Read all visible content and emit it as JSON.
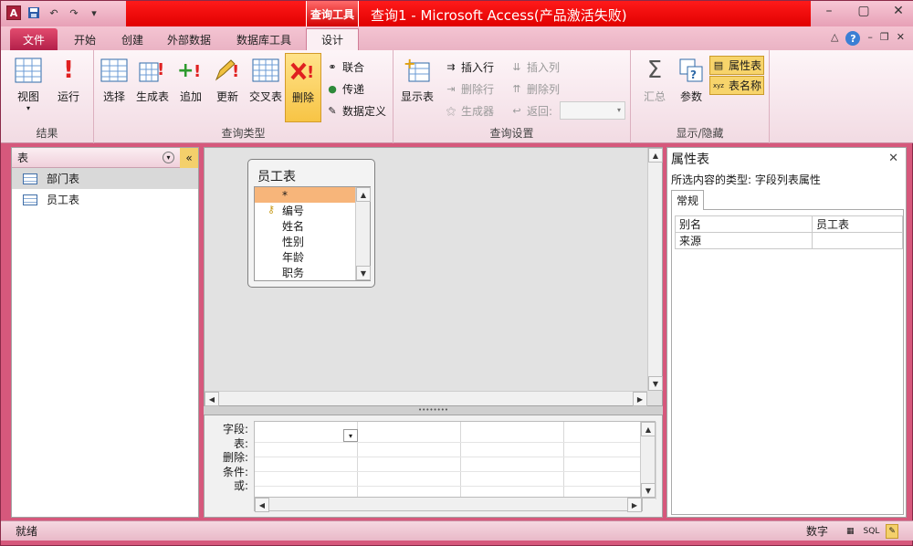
{
  "window": {
    "title": "查询1 - Microsoft Access(产品激活失败)",
    "context_tab": "查询工具"
  },
  "tabs": [
    {
      "label": "文件"
    },
    {
      "label": "开始"
    },
    {
      "label": "创建"
    },
    {
      "label": "外部数据"
    },
    {
      "label": "数据库工具"
    },
    {
      "label": "设计"
    }
  ],
  "ribbon": {
    "results": {
      "label": "结果",
      "view": "视图",
      "run": "运行"
    },
    "query_type": {
      "label": "查询类型",
      "select": "选择",
      "make_table": "生成表",
      "append": "追加",
      "update": "更新",
      "crosstab": "交叉表",
      "delete": "删除",
      "union": "联合",
      "pass_through": "传递",
      "data_definition": "数据定义"
    },
    "query_setup": {
      "label": "查询设置",
      "show_table": "显示表",
      "insert_rows": "插入行",
      "delete_rows": "删除行",
      "builder": "生成器",
      "insert_columns": "插入列",
      "delete_columns": "删除列",
      "return": "返回:"
    },
    "show_hide": {
      "label": "显示/隐藏",
      "totals": "汇总",
      "parameters": "参数",
      "property_sheet": "属性表",
      "table_names": "表名称"
    }
  },
  "nav": {
    "header": "表",
    "items": [
      "部门表",
      "员工表"
    ]
  },
  "field_list": {
    "title": "员工表",
    "fields": [
      "*",
      "编号",
      "姓名",
      "性别",
      "年龄",
      "职务"
    ]
  },
  "grid": {
    "row_labels": [
      "字段:",
      "表:",
      "删除:",
      "条件:",
      "或:"
    ]
  },
  "property_sheet": {
    "title": "属性表",
    "selection_type": "所选内容的类型: 字段列表属性",
    "tab": "常规",
    "rows": [
      {
        "name": "别名",
        "value": "员工表"
      },
      {
        "name": "来源",
        "value": ""
      }
    ]
  },
  "status": {
    "left": "就绪",
    "right": "数字",
    "sql": "SQL"
  },
  "colors": {
    "accent": "#d6587c",
    "context_band": "#e00000",
    "selected_field": "#f7b57a"
  }
}
